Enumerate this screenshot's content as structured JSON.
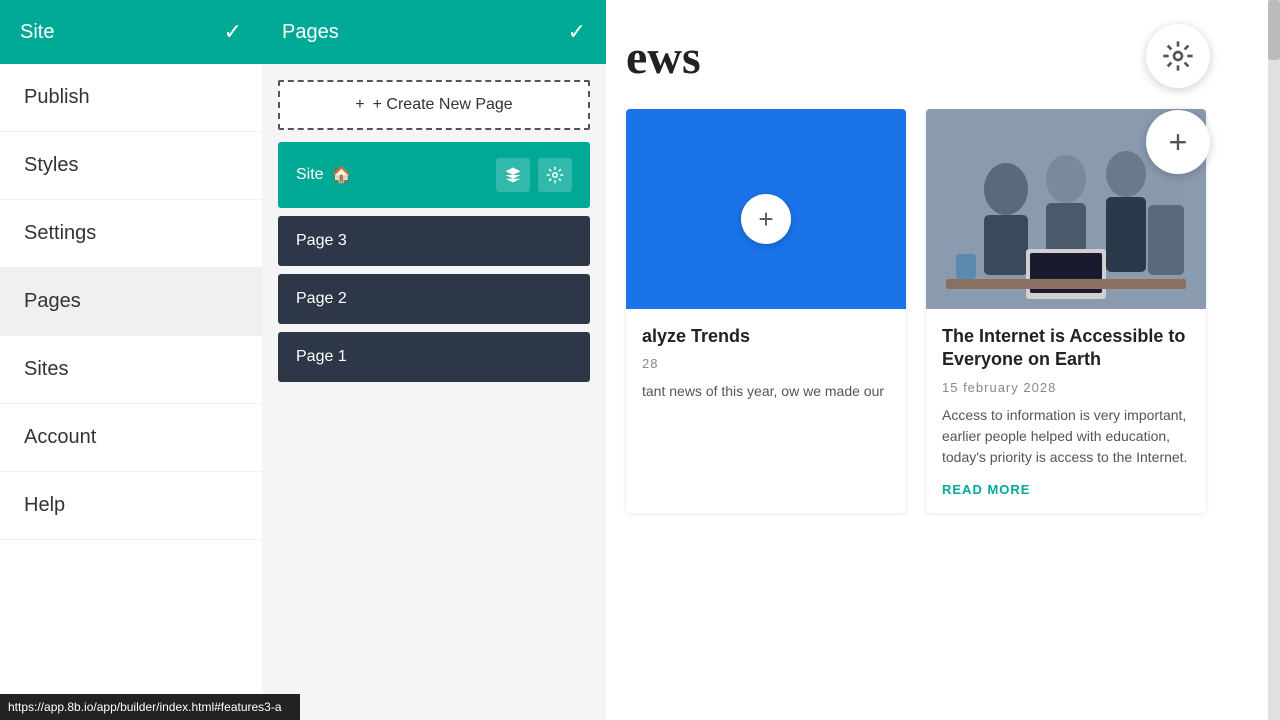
{
  "sidebar": {
    "title": "Site",
    "check_mark": "✓",
    "items": [
      {
        "id": "publish",
        "label": "Publish",
        "active": false
      },
      {
        "id": "styles",
        "label": "Styles",
        "active": false
      },
      {
        "id": "settings",
        "label": "Settings",
        "active": false
      },
      {
        "id": "pages",
        "label": "Pages",
        "active": true
      },
      {
        "id": "sites",
        "label": "Sites",
        "active": false
      },
      {
        "id": "account",
        "label": "Account",
        "active": false
      },
      {
        "id": "help",
        "label": "Help",
        "active": false
      }
    ]
  },
  "pages_panel": {
    "title": "Pages",
    "check_mark": "✓",
    "create_label": "+ Create New Page",
    "site_item": {
      "label": "Site",
      "home_icon": "🏠"
    },
    "pages": [
      {
        "label": "Page 3"
      },
      {
        "label": "Page 2"
      },
      {
        "label": "Page 1"
      }
    ]
  },
  "news": {
    "title": "ews",
    "cards": [
      {
        "id": "card1",
        "title": "alyze Trends",
        "date": "28",
        "text": "tant news of this year, ow we made our",
        "has_image": false,
        "bg_color": "#1a73e8"
      },
      {
        "id": "card2",
        "title": "The Internet is Accessible to Everyone on Earth",
        "date": "15 february 2028",
        "text": "Access to information is very important, earlier people helped with education, today's priority is access to the Internet.",
        "read_more": "READ MORE",
        "has_image": true
      }
    ]
  },
  "fabs": {
    "gear_icon": "⚙",
    "plus_icon": "+"
  },
  "status_bar": {
    "url": "https://app.8b.io/app/builder/index.html#features3-a"
  }
}
